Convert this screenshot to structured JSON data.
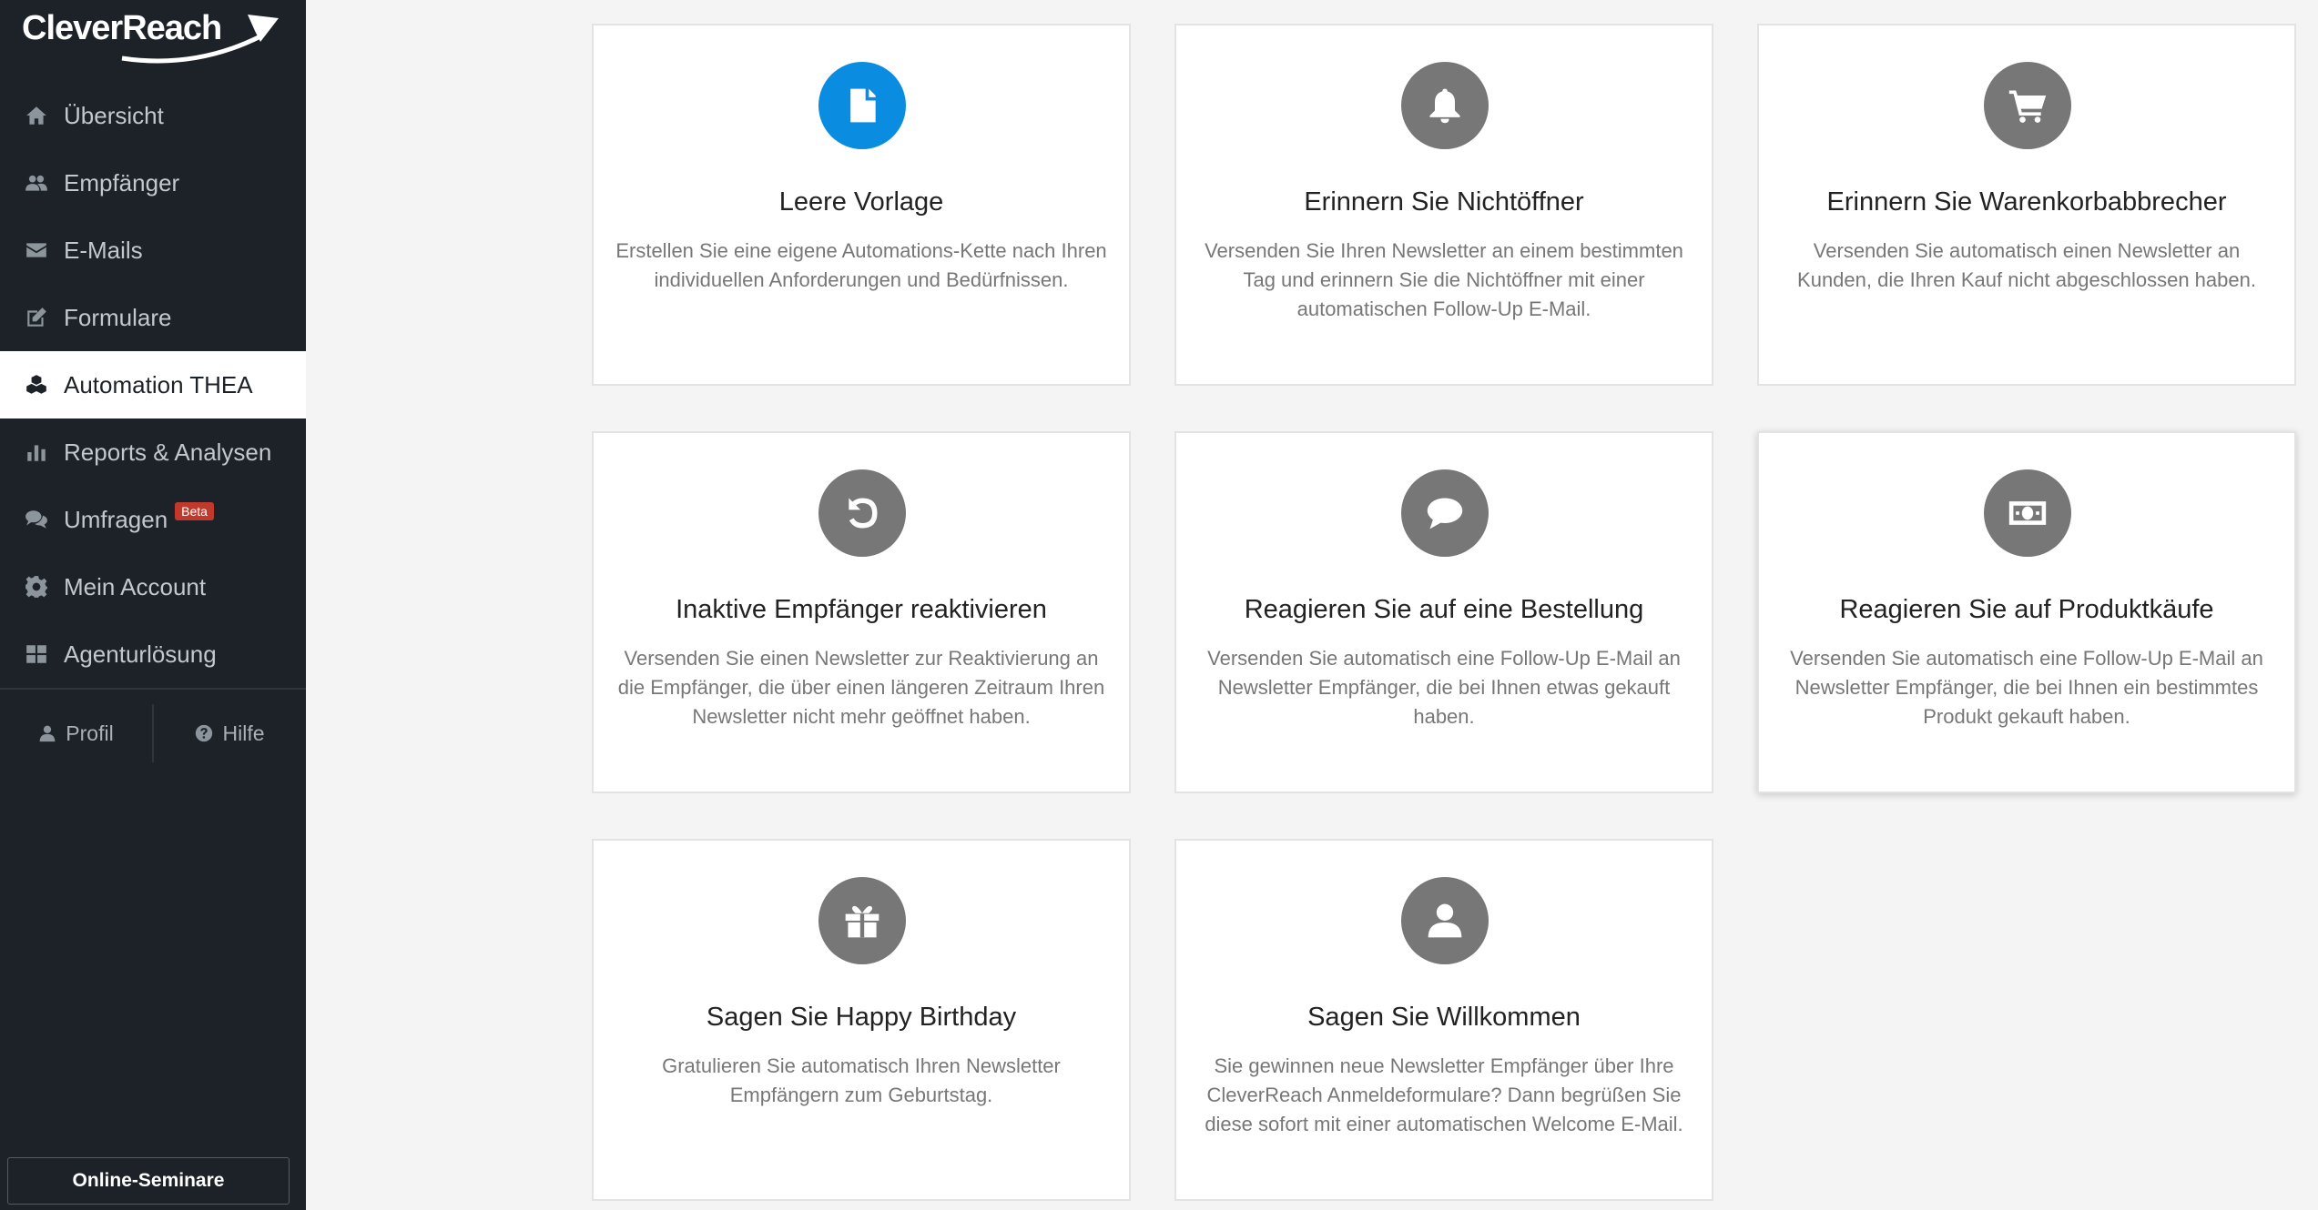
{
  "app": {
    "logo_text": "CleverReach",
    "accent_color": "#0a8de0",
    "icon_color": "#777777"
  },
  "sidebar": {
    "items": [
      {
        "label": "Übersicht",
        "icon": "home-icon"
      },
      {
        "label": "Empfänger",
        "icon": "users-icon"
      },
      {
        "label": "E-Mails",
        "icon": "envelope-icon"
      },
      {
        "label": "Formulare",
        "icon": "edit-icon"
      },
      {
        "label": "Automation THEA",
        "icon": "cubes-icon",
        "active": true
      },
      {
        "label": "Reports & Analysen",
        "icon": "bar-chart-icon"
      },
      {
        "label": "Umfragen",
        "icon": "comments-icon",
        "badge": "Beta"
      },
      {
        "label": "Mein Account",
        "icon": "gear-icon"
      },
      {
        "label": "Agenturlösung",
        "icon": "grid-icon"
      }
    ],
    "profile_label": "Profil",
    "help_label": "Hilfe",
    "seminar_button": "Online-Seminare"
  },
  "cards": [
    {
      "title": "Leere Vorlage",
      "description": "Erstellen Sie eine eigene Automations-Kette nach Ihren individuellen Anforderungen und Bedürfnissen.",
      "icon": "file-icon"
    },
    {
      "title": "Erinnern Sie Nichtöffner",
      "description": "Versenden Sie Ihren Newsletter an einem bestimmten Tag und erinnern Sie die Nichtöffner mit einer automatischen Follow-Up E-Mail.",
      "icon": "bell-icon"
    },
    {
      "title": "Erinnern Sie Warenkorbabbrecher",
      "description": "Versenden Sie automatisch einen Newsletter an Kunden, die Ihren Kauf nicht abgeschlossen haben.",
      "icon": "cart-icon"
    },
    {
      "title": "Inaktive Empfänger reaktivieren",
      "description": "Versenden Sie einen Newsletter zur Reaktivierung an die Empfänger, die über einen längeren Zeitraum Ihren Newsletter nicht mehr geöffnet haben.",
      "icon": "undo-icon"
    },
    {
      "title": "Reagieren Sie auf eine Bestellung",
      "description": "Versenden Sie automatisch eine Follow-Up E-Mail an Newsletter Empfänger, die bei Ihnen etwas gekauft haben.",
      "icon": "comment-icon"
    },
    {
      "title": "Reagieren Sie auf Produktkäufe",
      "description": "Versenden Sie automatisch eine Follow-Up E-Mail an Newsletter Empfänger, die bei Ihnen ein bestimmtes Produkt gekauft haben.",
      "icon": "money-icon"
    },
    {
      "title": "Sagen Sie Happy Birthday",
      "description": "Gratulieren Sie automatisch Ihren Newsletter Empfängern zum Geburtstag.",
      "icon": "gift-icon"
    },
    {
      "title": "Sagen Sie Willkommen",
      "description": "Sie gewinnen neue Newsletter Empfänger über Ihre CleverReach Anmeldeformulare? Dann begrüßen Sie diese sofort mit einer automatischen Welcome E-Mail.",
      "icon": "user-icon"
    }
  ]
}
